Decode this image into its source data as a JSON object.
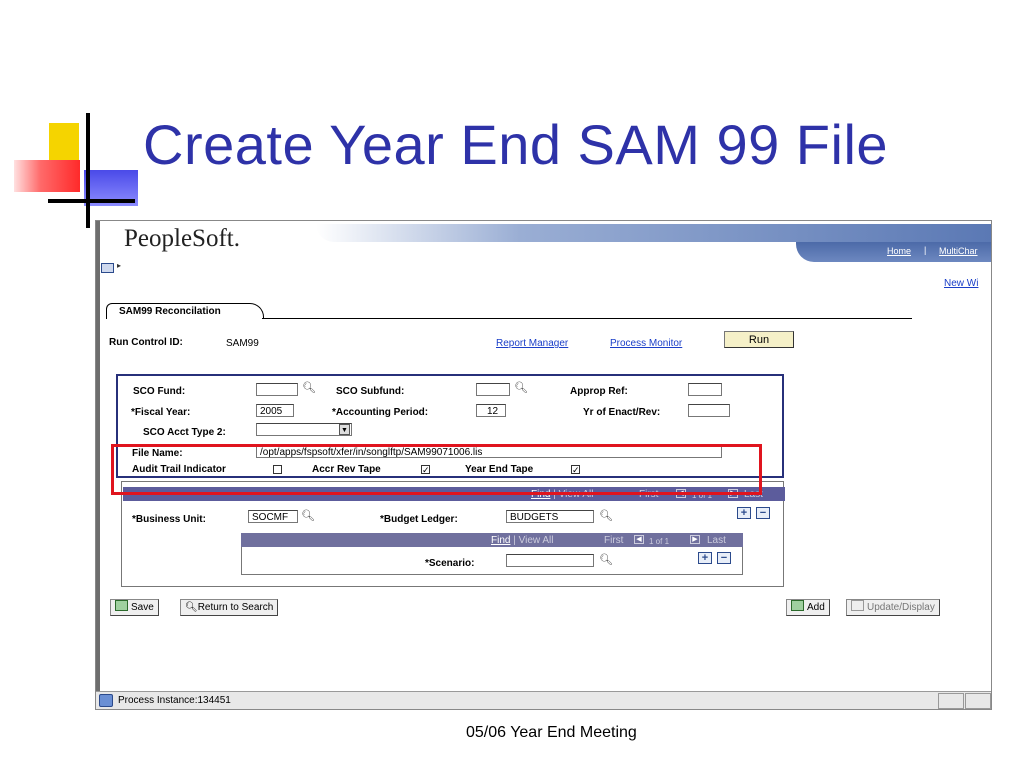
{
  "slide": {
    "title": "Create Year End SAM 99 File",
    "footer": "05/06 Year End Meeting"
  },
  "app": {
    "logo": "PeopleSoft.",
    "nav": {
      "home": "Home",
      "separator": "|",
      "multichannel": "MultiChar",
      "new_window": "New Wi"
    },
    "tab": "SAM99 Reconcilation"
  },
  "run_control": {
    "label": "Run Control ID:",
    "value": "SAM99",
    "report_manager": "Report Manager",
    "process_monitor": "Process Monitor",
    "run_button": "Run"
  },
  "form": {
    "sco_fund": {
      "label": "SCO Fund:",
      "value": ""
    },
    "sco_subfund": {
      "label": "SCO Subfund:",
      "value": ""
    },
    "approp_ref": {
      "label": "Approp Ref:",
      "value": ""
    },
    "fiscal_year": {
      "label": "*Fiscal Year:",
      "value": "2005"
    },
    "accounting_period": {
      "label": "*Accounting Period:",
      "value": "12"
    },
    "yr_of_enact": {
      "label": "Yr of Enact/Rev:",
      "value": ""
    },
    "sco_acct_type2": {
      "label": "SCO Acct Type 2:",
      "value": ""
    },
    "file_name": {
      "label": "File Name:",
      "value": "/opt/apps/fspsoft/xfer/in/songlftp/SAM99071006.lis"
    },
    "audit_trail": {
      "label": "Audit Trail Indicator",
      "checked": false
    },
    "accr_rev_tape": {
      "label": "Accr Rev Tape",
      "checked": true
    },
    "year_end_tape": {
      "label": "Year End Tape",
      "checked": true
    }
  },
  "grid1": {
    "find": "Find",
    "view_all": "| View All",
    "first": "First",
    "range": "1 of 1",
    "last": "Last",
    "business_unit": {
      "label": "*Business Unit:",
      "value": "SOCMF"
    },
    "budget_ledger": {
      "label": "*Budget Ledger:",
      "value": "BUDGETS"
    }
  },
  "grid2": {
    "find": "Find",
    "view_all": "| View All",
    "first": "First",
    "range": "1 of 1",
    "last": "Last",
    "scenario": {
      "label": "*Scenario:",
      "value": ""
    }
  },
  "toolbar": {
    "save": "Save",
    "return_to_search": "Return to Search",
    "add": "Add",
    "update_display": "Update/Display"
  },
  "status": {
    "text": "Process Instance:134451"
  },
  "colors": {
    "title": "#2e32a8",
    "highlight": "#e0141e",
    "section_border": "#27307a"
  }
}
